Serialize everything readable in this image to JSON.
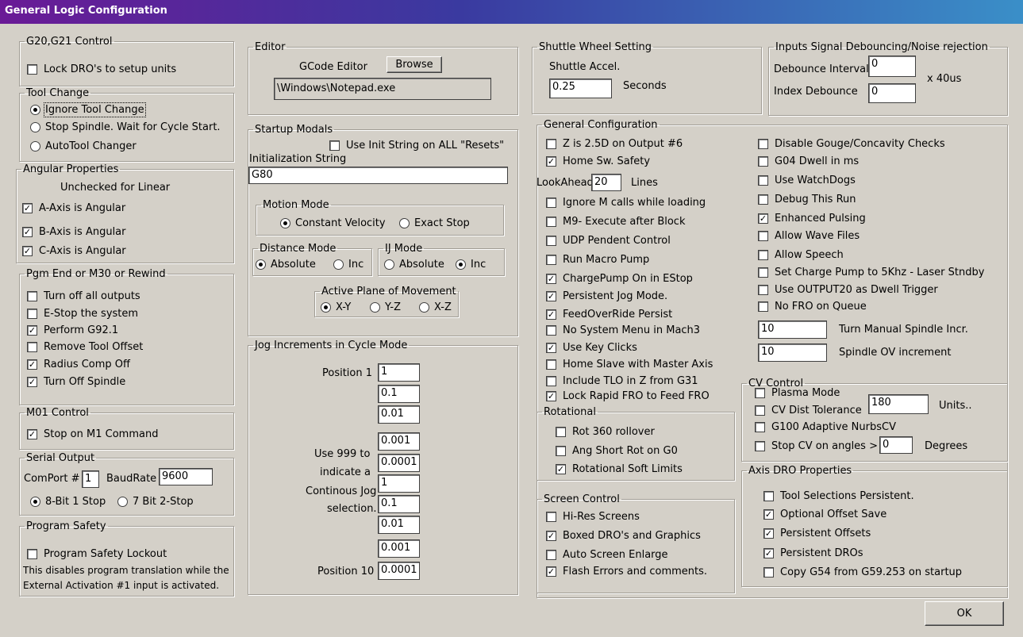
{
  "window": {
    "title": "General Logic Configuration"
  },
  "g20_g21": {
    "legend": "G20,G21 Control",
    "items": [
      {
        "label": "Lock DRO's to setup units",
        "checked": false
      }
    ]
  },
  "tool_change": {
    "legend": "Tool Change",
    "options": [
      {
        "label": "Ignore Tool Change",
        "selected": true
      },
      {
        "label": "Stop Spindle. Wait for Cycle Start.",
        "selected": false
      },
      {
        "label": "AutoTool Changer",
        "selected": false
      }
    ]
  },
  "angular": {
    "legend": "Angular Properties",
    "note": "Unchecked for Linear",
    "items": [
      {
        "label": "A-Axis is Angular",
        "checked": true
      },
      {
        "label": "B-Axis is Angular",
        "checked": true
      },
      {
        "label": "C-Axis is Angular",
        "checked": true
      }
    ]
  },
  "pgm_end": {
    "legend": "Pgm End or M30 or Rewind",
    "items": [
      {
        "label": "Turn off all outputs",
        "checked": false
      },
      {
        "label": "E-Stop the system",
        "checked": false
      },
      {
        "label": "Perform G92.1",
        "checked": true
      },
      {
        "label": "Remove Tool Offset",
        "checked": false
      },
      {
        "label": "Radius Comp Off",
        "checked": true
      },
      {
        "label": "Turn Off Spindle",
        "checked": true
      }
    ]
  },
  "m01": {
    "legend": "M01 Control",
    "items": [
      {
        "label": "Stop on M1 Command",
        "checked": true
      }
    ]
  },
  "serial": {
    "legend": "Serial Output",
    "comport_label": "ComPort #",
    "comport_value": "1",
    "baud_label": "BaudRate",
    "baud_value": "9600",
    "options": [
      {
        "label": "8-Bit 1 Stop",
        "selected": true
      },
      {
        "label": "7 Bit 2-Stop",
        "selected": false
      }
    ]
  },
  "program_safety": {
    "legend": "Program Safety",
    "items": [
      {
        "label": "Program Safety Lockout",
        "checked": false
      }
    ],
    "note1": "This disables program translation while the",
    "note2": "External Activation #1 input is activated."
  },
  "editor": {
    "legend": "Editor",
    "label": "GCode Editor",
    "browse": "Browse",
    "path": "\\Windows\\Notepad.exe"
  },
  "startup": {
    "legend": "Startup Modals",
    "init_all": {
      "label": "Use Init String on ALL  \"Resets\"",
      "checked": false
    },
    "init_label": "Initialization String",
    "init_value": "G80",
    "motion": {
      "legend": "Motion Mode",
      "options": [
        {
          "label": "Constant Velocity",
          "selected": true
        },
        {
          "label": "Exact Stop",
          "selected": false
        }
      ]
    },
    "distance": {
      "legend": "Distance Mode",
      "options": [
        {
          "label": "Absolute",
          "selected": true
        },
        {
          "label": "Inc",
          "selected": false
        }
      ]
    },
    "ij": {
      "legend": "IJ Mode",
      "options": [
        {
          "label": "Absolute",
          "selected": false
        },
        {
          "label": "Inc",
          "selected": true
        }
      ]
    },
    "plane": {
      "legend": "Active Plane of Movement",
      "options": [
        {
          "label": "X-Y",
          "selected": true
        },
        {
          "label": "Y-Z",
          "selected": false
        },
        {
          "label": "X-Z",
          "selected": false
        }
      ]
    }
  },
  "jog": {
    "legend": "Jog Increments in Cycle Mode",
    "first_label": "Position 1",
    "last_label": "Position 10",
    "hint": [
      "Use 999 to",
      "indicate a",
      "Continous Jog",
      "selection."
    ],
    "values": [
      "1",
      "0.1",
      "0.01",
      "0.001",
      "0.0001",
      "1",
      "0.1",
      "0.01",
      "0.001",
      "0.0001"
    ]
  },
  "shuttle": {
    "legend": "Shuttle Wheel Setting",
    "accel_label": "Shuttle Accel.",
    "accel_value": "0.25",
    "unit": "Seconds"
  },
  "debounce": {
    "legend": "Inputs Signal Debouncing/Noise rejection",
    "interval_label": "Debounce Interval",
    "interval_value": "0",
    "index_label": "Index Debounce",
    "index_value": "0",
    "unit": "x 40us"
  },
  "general": {
    "legend": "General Configuration",
    "left_items": [
      {
        "label": "Z is 2.5D on Output #6",
        "checked": false
      },
      {
        "label": "Home Sw. Safety",
        "checked": true
      }
    ],
    "lookahead_label": "LookAhead",
    "lookahead_value": "20",
    "lookahead_unit": "Lines",
    "left_items2": [
      {
        "label": "Ignore M calls while loading",
        "checked": false
      },
      {
        "label": "M9- Execute after Block",
        "checked": false
      },
      {
        "label": "UDP Pendent Control",
        "checked": false
      },
      {
        "label": "Run Macro Pump",
        "checked": false
      },
      {
        "label": "ChargePump On in EStop",
        "checked": true
      },
      {
        "label": "Persistent Jog Mode.",
        "checked": true
      },
      {
        "label": "FeedOverRide Persist",
        "checked": true
      },
      {
        "label": "No System Menu in Mach3",
        "checked": false
      },
      {
        "label": "Use Key Clicks",
        "checked": true
      },
      {
        "label": "Home Slave with Master Axis",
        "checked": false
      },
      {
        "label": "Include TLO in Z from G31",
        "checked": false
      },
      {
        "label": "Lock Rapid FRO to Feed FRO",
        "checked": true
      }
    ],
    "right_items": [
      {
        "label": "Disable Gouge/Concavity Checks",
        "checked": false
      },
      {
        "label": "G04 Dwell in ms",
        "checked": false
      },
      {
        "label": "Use WatchDogs",
        "checked": false
      },
      {
        "label": "Debug This Run",
        "checked": false
      },
      {
        "label": "Enhanced Pulsing",
        "checked": true
      },
      {
        "label": "Allow Wave Files",
        "checked": false
      },
      {
        "label": "Allow Speech",
        "checked": false
      },
      {
        "label": "Set Charge Pump to 5Khz  - Laser Stndby",
        "checked": false
      },
      {
        "label": "Use OUTPUT20 as Dwell Trigger",
        "checked": false
      },
      {
        "label": "No FRO on Queue",
        "checked": false
      }
    ],
    "spindle_incr_value": "10",
    "spindle_incr_label": "Turn Manual Spindle Incr.",
    "spindle_ov_value": "10",
    "spindle_ov_label": "Spindle OV increment"
  },
  "rotational": {
    "legend": "Rotational",
    "items": [
      {
        "label": "Rot 360 rollover",
        "checked": false
      },
      {
        "label": "Ang Short Rot on G0",
        "checked": false
      },
      {
        "label": "Rotational Soft Limits",
        "checked": true
      }
    ]
  },
  "screen": {
    "legend": "Screen Control",
    "items": [
      {
        "label": "Hi-Res Screens",
        "checked": false
      },
      {
        "label": "Boxed DRO's and Graphics",
        "checked": true
      },
      {
        "label": "Auto Screen Enlarge",
        "checked": false
      },
      {
        "label": "Flash Errors and comments.",
        "checked": true
      }
    ]
  },
  "cv": {
    "legend": "CV Control",
    "plasma": {
      "label": "Plasma Mode",
      "checked": false
    },
    "dist": {
      "label": "CV Dist Tolerance",
      "checked": false,
      "value": "180",
      "unit": "Units.."
    },
    "g100": {
      "label": "G100 Adaptive NurbsCV",
      "checked": false
    },
    "angles": {
      "label": "Stop CV on angles >",
      "checked": false,
      "value": "0",
      "unit": "Degrees"
    }
  },
  "axis_dro": {
    "legend": "Axis DRO Properties",
    "items": [
      {
        "label": "Tool Selections Persistent.",
        "checked": false
      },
      {
        "label": "Optional Offset Save",
        "checked": true
      },
      {
        "label": "Persistent Offsets",
        "checked": true
      },
      {
        "label": "Persistent DROs",
        "checked": true
      },
      {
        "label": "Copy G54 from G59.253 on startup",
        "checked": false
      }
    ]
  },
  "ok": "OK"
}
